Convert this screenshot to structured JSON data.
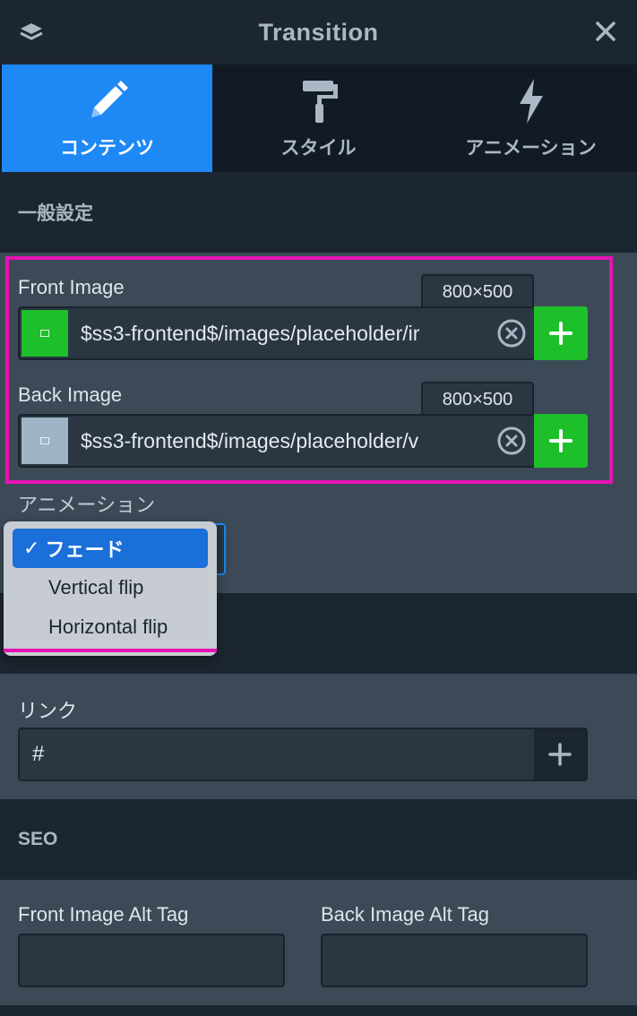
{
  "header": {
    "title": "Transition",
    "layers_icon": "layers-icon",
    "close_icon": "close-icon"
  },
  "tabs": [
    {
      "label": "コンテンツ",
      "icon": "pencil-icon",
      "active": true
    },
    {
      "label": "スタイル",
      "icon": "paint-roller-icon",
      "active": false
    },
    {
      "label": "アニメーション",
      "icon": "lightning-icon",
      "active": false
    }
  ],
  "general": {
    "section_title": "一般設定",
    "front": {
      "label": "Front Image",
      "size": "800×500",
      "path": "$ss3-frontend$/images/placeholder/ir",
      "thumb_color": "#1ec02a"
    },
    "back": {
      "label": "Back Image",
      "size": "800×500",
      "path": "$ss3-frontend$/images/placeholder/v",
      "thumb_color": "#9fb4c4"
    },
    "animation": {
      "label": "アニメーション",
      "options": [
        "フェード",
        "Vertical flip",
        "Horizontal flip"
      ],
      "selected": "フェード"
    }
  },
  "link": {
    "label": "リンク",
    "value": "#"
  },
  "seo": {
    "section_title": "SEO",
    "front_alt_label": "Front Image Alt Tag",
    "back_alt_label": "Back Image Alt Tag",
    "front_alt_value": "",
    "back_alt_value": ""
  },
  "colors": {
    "accent": "#1e88f4",
    "add_button": "#1ec02a",
    "highlight": "#e514b4"
  }
}
